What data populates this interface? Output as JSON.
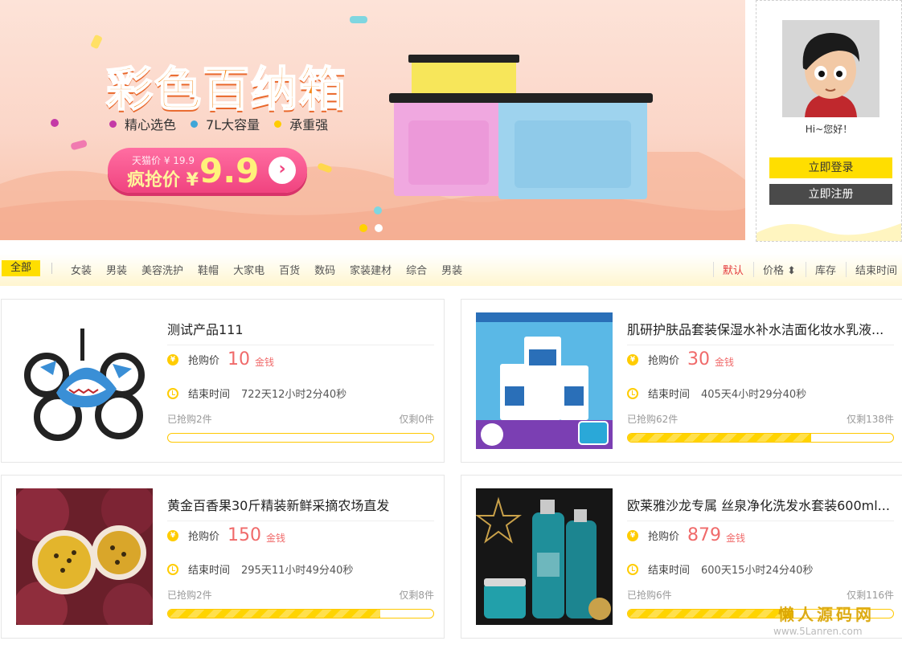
{
  "banner": {
    "title": "彩色百纳箱",
    "features": [
      {
        "text": "精心选色",
        "color": "#c43aa6"
      },
      {
        "text": "7L大容量",
        "color": "#3fa6d8"
      },
      {
        "text": "承重强",
        "color": "#ffcc00"
      }
    ],
    "original_price": "天猫价 ¥ 19.9",
    "promo_label": "疯抢价 ¥",
    "promo_price": "9.9",
    "carousel_active": 1,
    "carousel_count": 2
  },
  "user": {
    "greeting": "Hi~您好！",
    "login_label": "立即登录",
    "register_label": "立即注册"
  },
  "categories": {
    "all_label": "全部",
    "items": [
      "女装",
      "男装",
      "美容洗护",
      "鞋帽",
      "大家电",
      "百货",
      "数码",
      "家装建材",
      "综合",
      "男装"
    ]
  },
  "sort": [
    "默认",
    "价格 ⬍",
    "库存",
    "结束时间"
  ],
  "products": [
    {
      "name": "测试产品111",
      "price_label": "抢购价",
      "price": "10",
      "unit": "金钱",
      "end_label": "结束时间",
      "end_time": "722天12小时2分40秒",
      "sold": "已抢购2件",
      "left": "仅剩0件",
      "progress": 0
    },
    {
      "name": "肌研护肤品套装保湿水补水洁面化妆水乳液...",
      "price_label": "抢购价",
      "price": "30",
      "unit": "金钱",
      "end_label": "结束时间",
      "end_time": "405天4小时29分40秒",
      "sold": "已抢购62件",
      "left": "仅剩138件",
      "progress": 0.69
    },
    {
      "name": "黄金百香果30斤精装新鲜采摘农场直发",
      "price_label": "抢购价",
      "price": "150",
      "unit": "金钱",
      "end_label": "结束时间",
      "end_time": "295天11小时49分40秒",
      "sold": "已抢购2件",
      "left": "仅剩8件",
      "progress": 0.8
    },
    {
      "name": "欧莱雅沙龙专属 丝泉净化洗发水套装600ml...",
      "price_label": "抢购价",
      "price": "879",
      "unit": "金钱",
      "end_label": "结束时间",
      "end_time": "600天15小时24分40秒",
      "sold": "已抢购6件",
      "left": "仅剩116件",
      "progress": 0.62
    }
  ],
  "watermark": {
    "cn": "懒人源码网",
    "url": "www.5Lanren.com"
  },
  "colors": {
    "accent": "#ffde00",
    "price": "#f06a6a",
    "dark_button": "#4a4a4a"
  }
}
